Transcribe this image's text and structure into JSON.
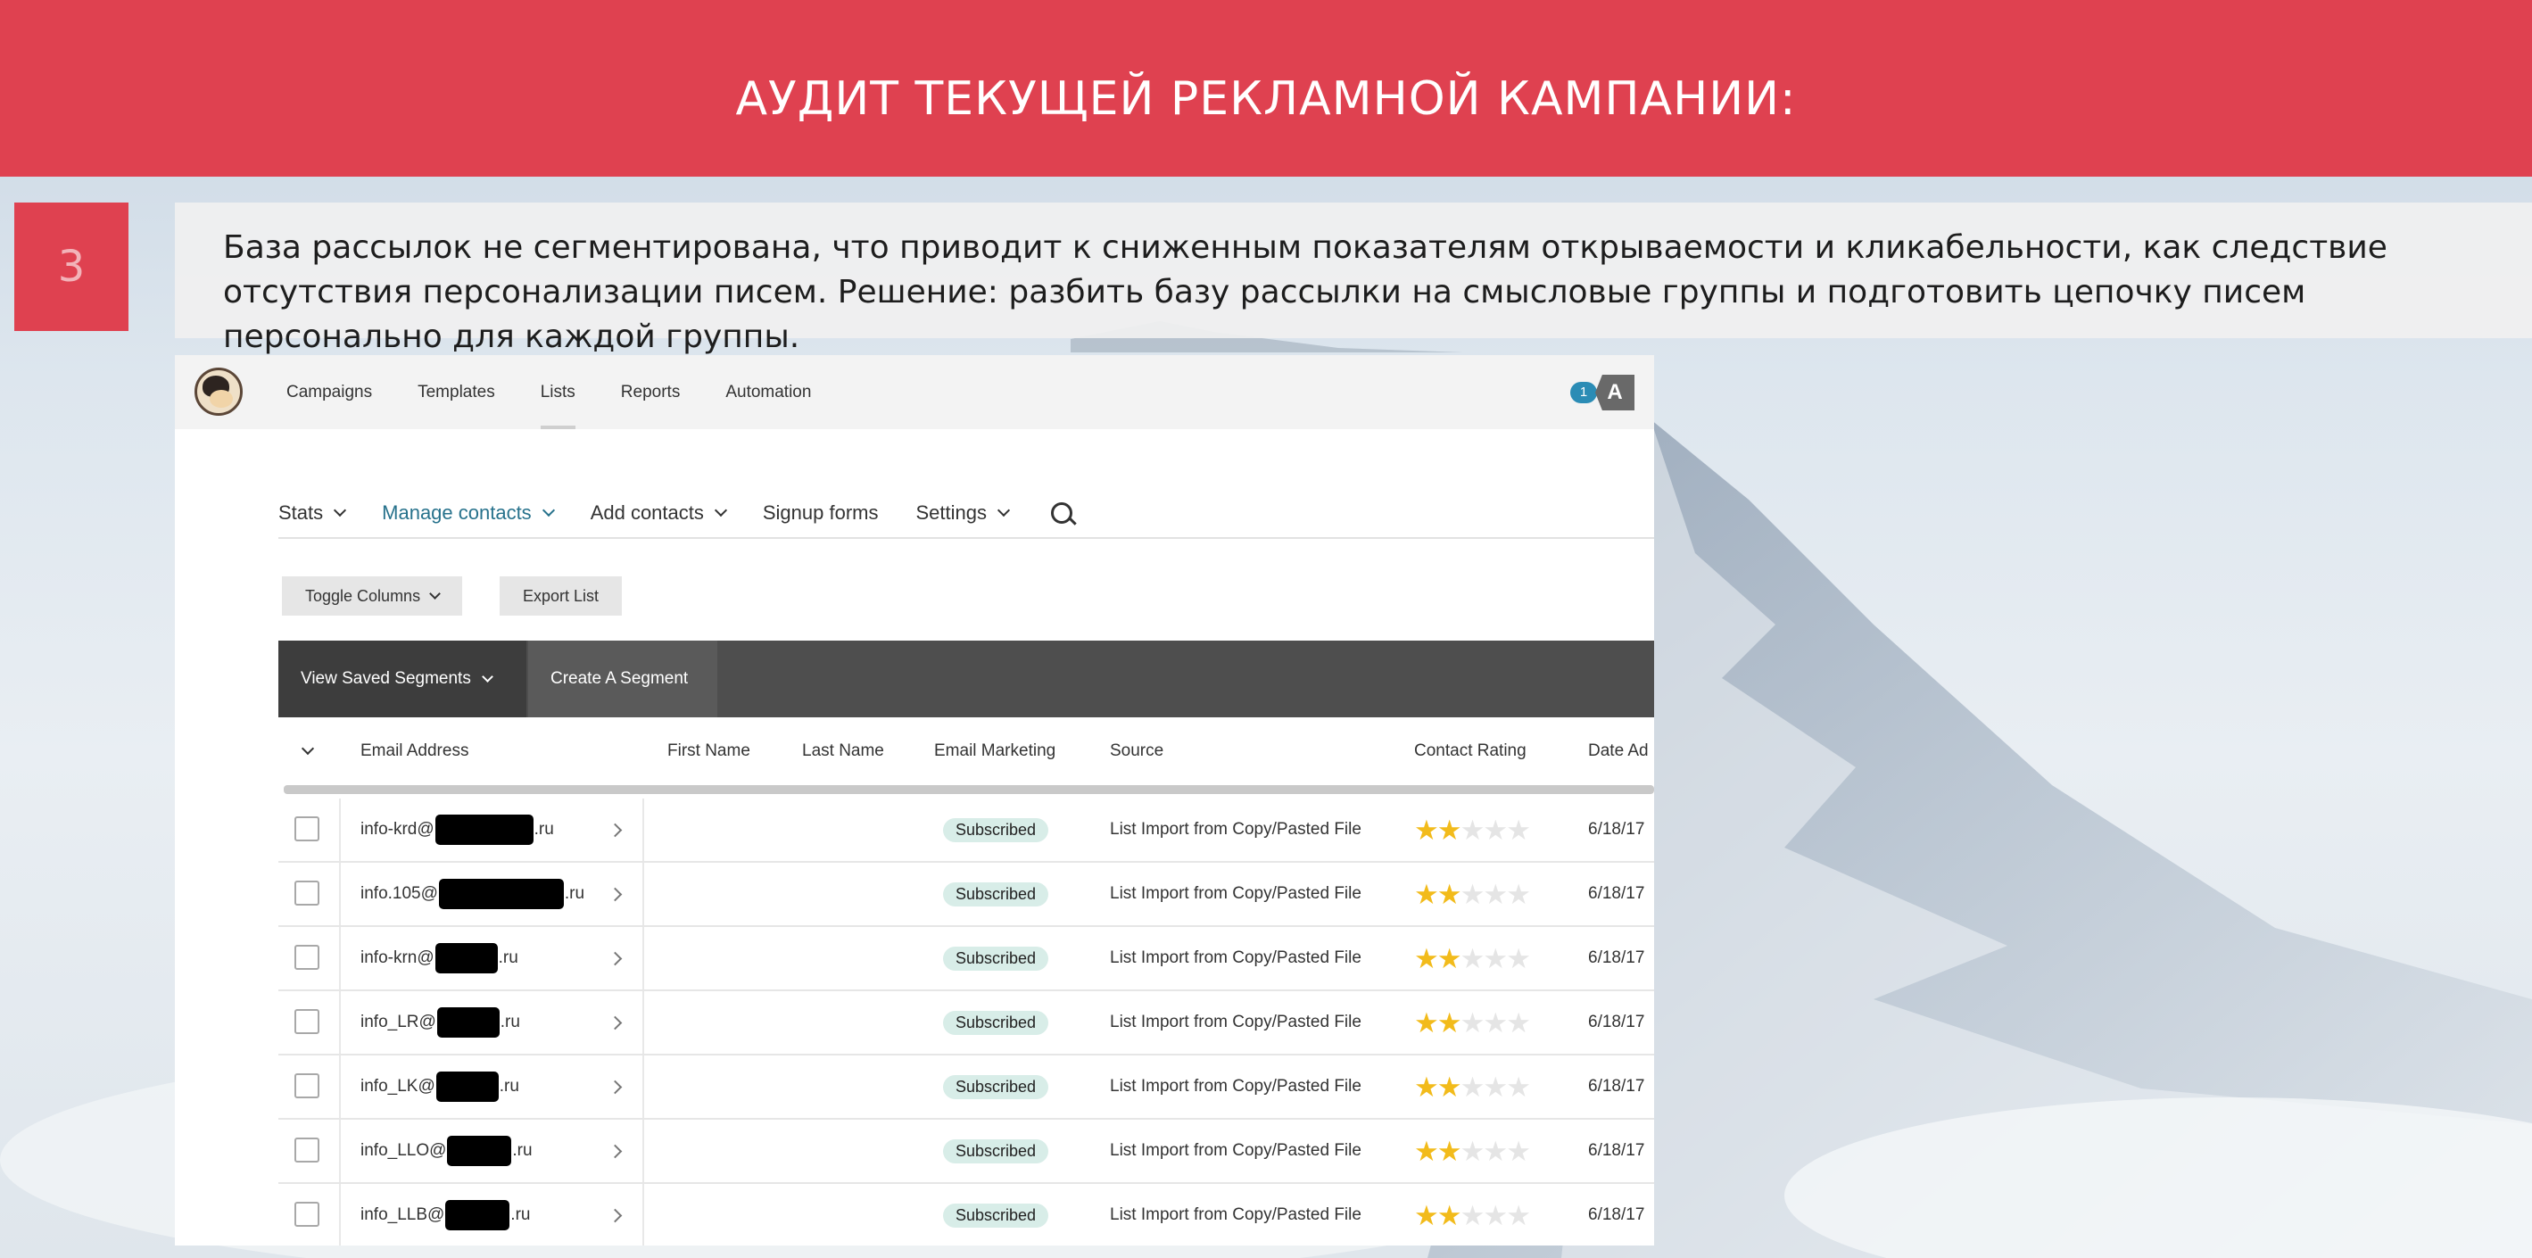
{
  "slide": {
    "title": "АУДИТ ТЕКУЩЕЙ РЕКЛАМНОЙ КАМПАНИИ:",
    "step_number": "3",
    "description": "База рассылок не сегментирована, что приводит к сниженным показателям открываемости и кликабельности, как следствие отсутствия персонализации писем. Решение: разбить базу рассылки на смысловые группы и подготовить цепочку писем персонально для каждой группы.",
    "colors": {
      "accent": "#df4150",
      "link": "#27728c",
      "badge": "#d8ede8",
      "star": "#f2bb1b"
    }
  },
  "app": {
    "logo_icon": "monkey-logo-icon",
    "nav": [
      "Campaigns",
      "Templates",
      "Lists",
      "Reports",
      "Automation"
    ],
    "active_nav": "Lists",
    "notification_count": "1",
    "account_initial": "A",
    "subnav": [
      "Stats",
      "Manage contacts",
      "Add contacts",
      "Signup forms",
      "Settings"
    ],
    "active_subnav": "Manage contacts",
    "toggle_columns": "Toggle Columns",
    "export_list": "Export List",
    "view_saved_segments": "View Saved Segments",
    "create_segment": "Create A Segment",
    "columns": {
      "email": "Email Address",
      "first_name": "First Name",
      "last_name": "Last Name",
      "email_marketing": "Email Marketing",
      "source": "Source",
      "contact_rating": "Contact Rating",
      "date_added": "Date Ad"
    },
    "rows": [
      {
        "email_prefix": "info-krd@",
        "email_suffix": ".ru",
        "status": "Subscribed",
        "source": "List Import from Copy/Pasted File",
        "rating": 2,
        "date": "6/18/17"
      },
      {
        "email_prefix": "info.105@",
        "email_suffix": ".ru",
        "status": "Subscribed",
        "source": "List Import from Copy/Pasted File",
        "rating": 2,
        "date": "6/18/17"
      },
      {
        "email_prefix": "info-krn@",
        "email_suffix": ".ru",
        "status": "Subscribed",
        "source": "List Import from Copy/Pasted File",
        "rating": 2,
        "date": "6/18/17"
      },
      {
        "email_prefix": "info_LR@",
        "email_suffix": ".ru",
        "status": "Subscribed",
        "source": "List Import from Copy/Pasted File",
        "rating": 2,
        "date": "6/18/17"
      },
      {
        "email_prefix": "info_LK@",
        "email_suffix": ".ru",
        "status": "Subscribed",
        "source": "List Import from Copy/Pasted File",
        "rating": 2,
        "date": "6/18/17"
      },
      {
        "email_prefix": "info_LLO@",
        "email_suffix": ".ru",
        "status": "Subscribed",
        "source": "List Import from Copy/Pasted File",
        "rating": 2,
        "date": "6/18/17"
      },
      {
        "email_prefix": "info_LLB@",
        "email_suffix": ".ru",
        "status": "Subscribed",
        "source": "List Import from Copy/Pasted File",
        "rating": 2,
        "date": "6/18/17"
      }
    ]
  }
}
